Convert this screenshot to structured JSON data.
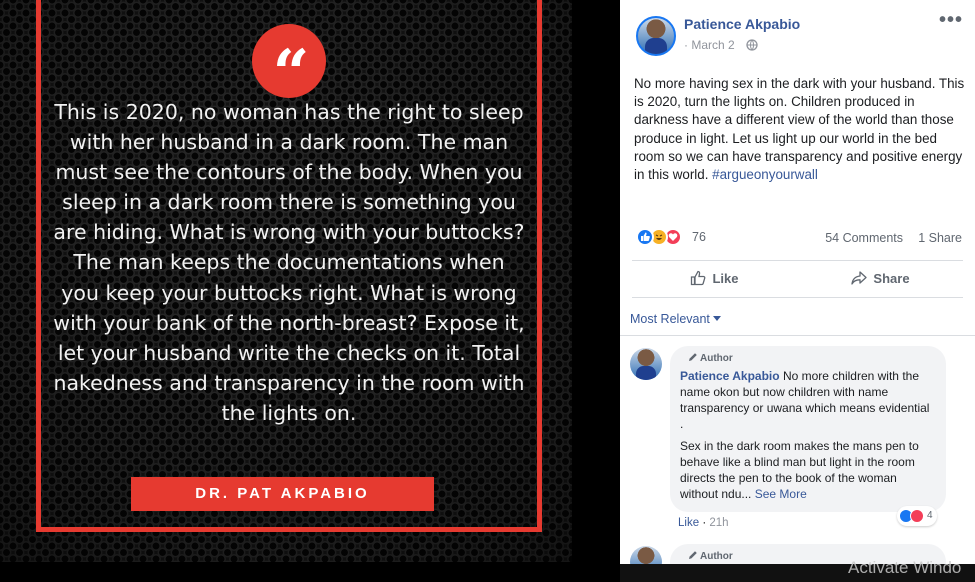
{
  "image_post": {
    "quote_mark": "“",
    "quote": "This is 2020, no woman has the right to sleep with her husband in a dark room. The man must see the contours of the body. When you sleep in a dark room there is something you are hiding. What is wrong with your buttocks? The man keeps the documentations when you keep your buttocks right. What is wrong with your bank of the north-breast? Expose it, let your husband write the checks on it. Total nakedness and transparency in the room with the lights on.",
    "author": "DR. PAT AKPABIO",
    "accent_color": "#e63a30"
  },
  "post": {
    "poster_name": "Patience Akpabio",
    "date": "March 2",
    "date_sep": "·",
    "more_icon": "•••",
    "text": "No more having sex in the dark with your husband. This is 2020, turn the lights on. Children produced in darkness have a different view of the world than those produce in light. Let us light up our world in the bed room so we can have transparency and positive energy in this world.",
    "hashtag": "#argueonyourwall",
    "reaction_count": "76",
    "comments": "54 Comments",
    "shares": "1 Share",
    "like_label": "Like",
    "share_label": "Share",
    "sort_label": "Most Relevant"
  },
  "comments": [
    {
      "author_tag": "Author",
      "name": "Patience Akpabio",
      "text1": "No more children with the name okon but now children with name transparency or uwana which means evidential .",
      "text2": "Sex in the dark room makes the mans pen to behave like a blind man but light in the room directs the pen to the book of the woman without ndu...",
      "see_more": "See More",
      "reaction_count": "4",
      "like_label": "Like",
      "time": "21h"
    },
    {
      "author_tag": "Author"
    }
  ],
  "overlay": {
    "watermark": "Activate Windo"
  }
}
